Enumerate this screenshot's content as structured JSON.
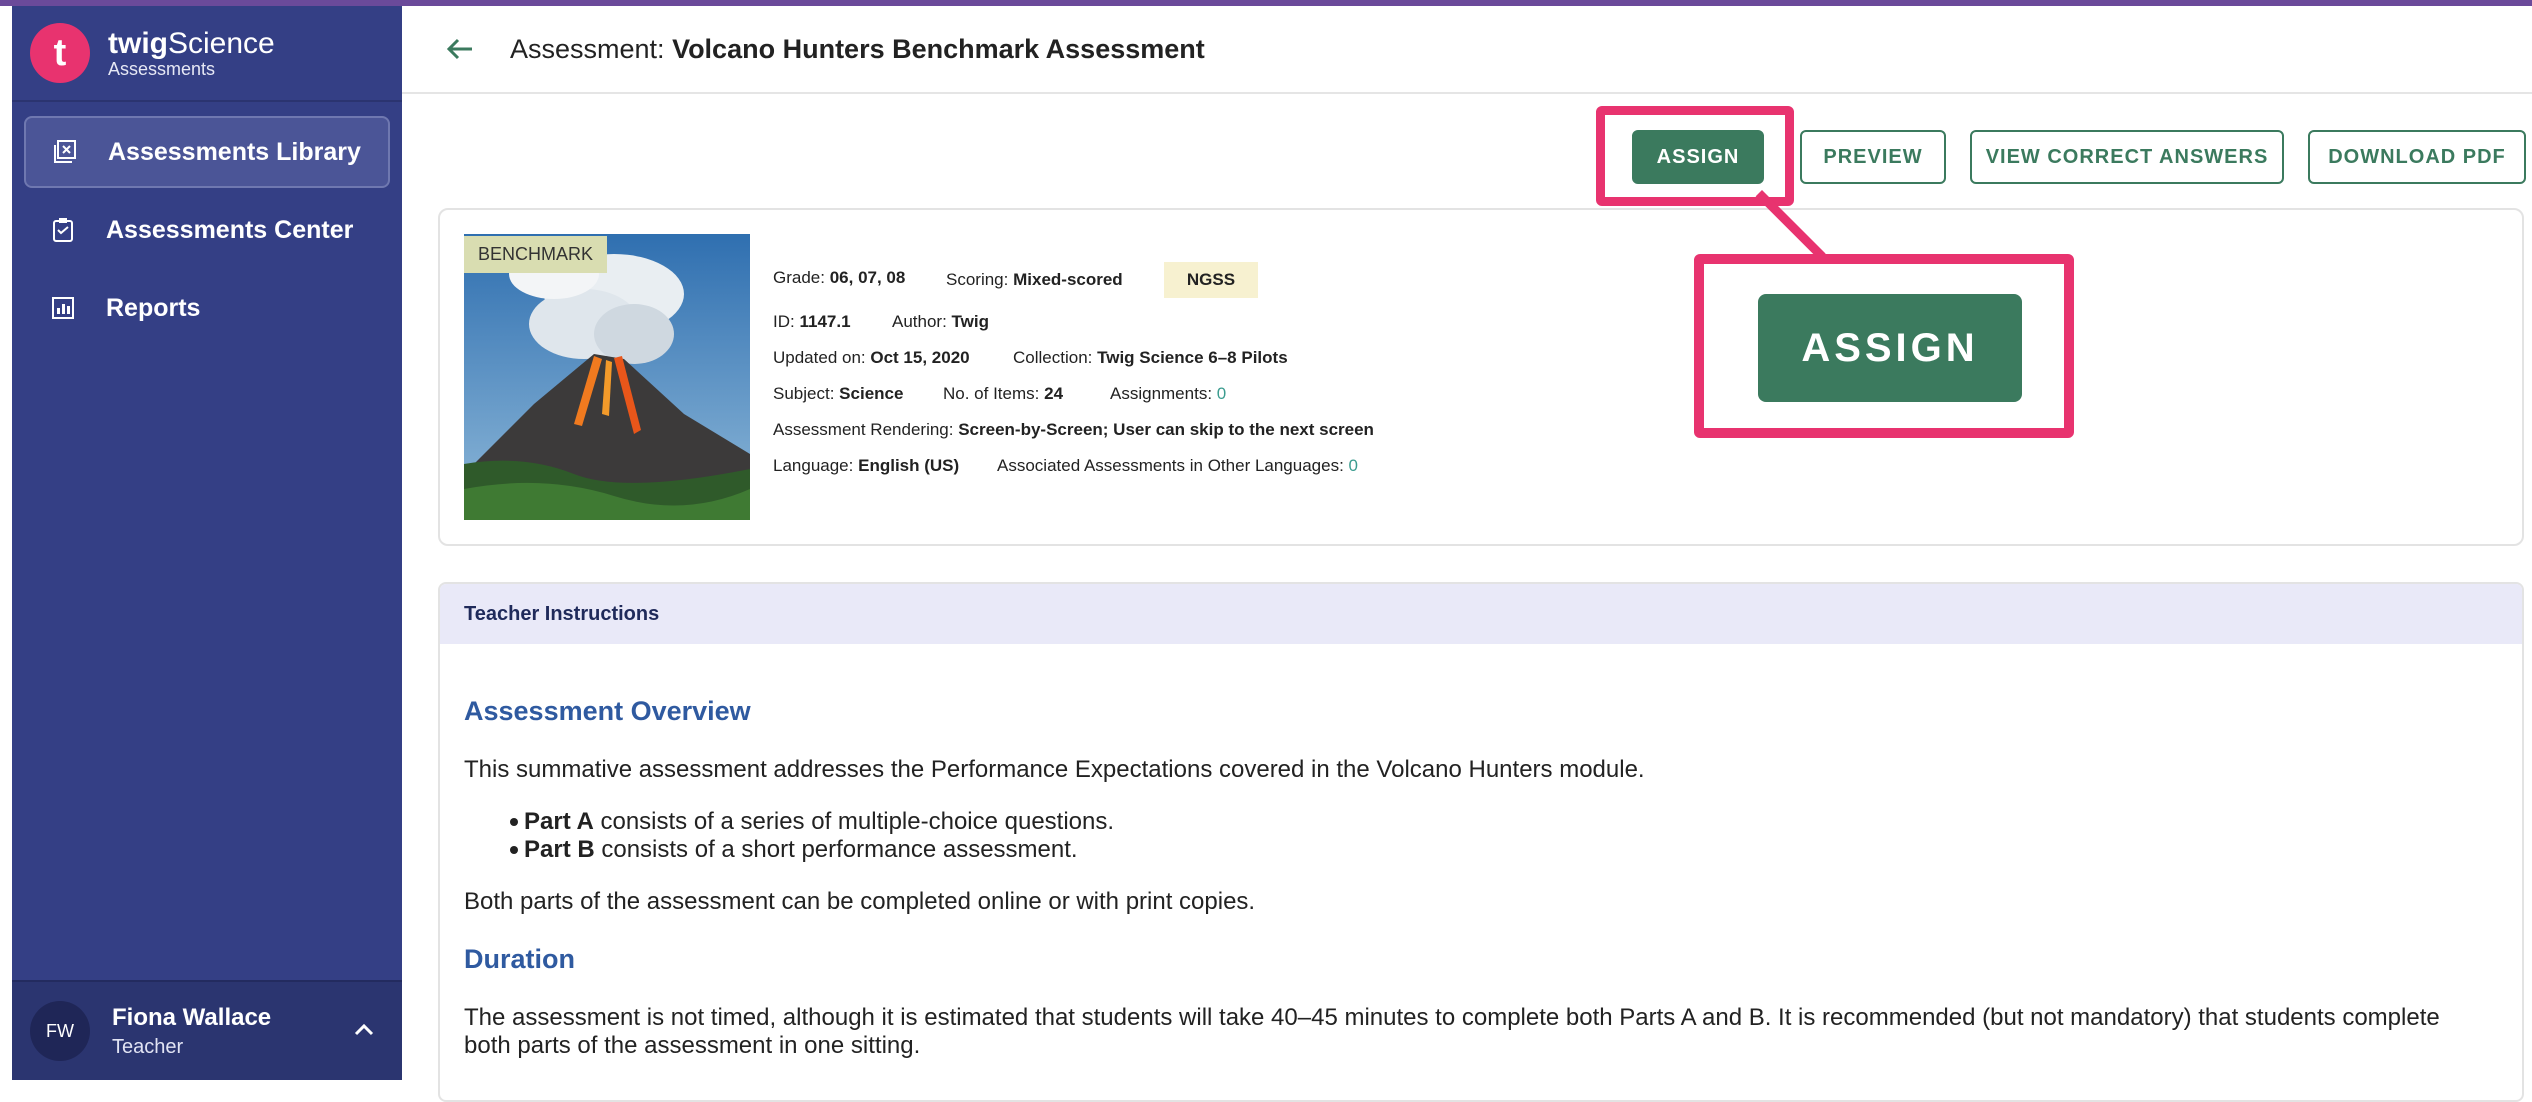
{
  "colors": {
    "sidebar": "#343f85",
    "accent_pink": "#e8336f",
    "primary_green": "#3b7a5e",
    "heading_blue": "#2f5aa0"
  },
  "brand": {
    "logo_letter": "t",
    "name_prefix": "twig",
    "name_suffix": "Science",
    "sub": "Assessments"
  },
  "nav": {
    "items": [
      {
        "label": "Assessments Library",
        "icon": "library-icon",
        "active": true
      },
      {
        "label": "Assessments Center",
        "icon": "clipboard-icon",
        "active": false
      },
      {
        "label": "Reports",
        "icon": "chart-icon",
        "active": false
      }
    ]
  },
  "user": {
    "initials": "FW",
    "name": "Fiona Wallace",
    "role": "Teacher"
  },
  "header": {
    "title_prefix": "Assessment: ",
    "title_name": "Volcano Hunters Benchmark Assessment"
  },
  "actions": {
    "assign": "ASSIGN",
    "preview": "PREVIEW",
    "view_answers": "VIEW CORRECT ANSWERS",
    "download": "DOWNLOAD PDF",
    "assign_zoom": "ASSIGN"
  },
  "details": {
    "badge": "BENCHMARK",
    "grade_label": "Grade:",
    "grade": "06, 07, 08",
    "scoring_label": "Scoring:",
    "scoring": "Mixed-scored",
    "standard": "NGSS",
    "id_label": "ID:",
    "id": "1147.1",
    "author_label": "Author:",
    "author": "Twig",
    "updated_label": "Updated on:",
    "updated": "Oct 15, 2020",
    "collection_label": "Collection:",
    "collection": "Twig Science 6–8 Pilots",
    "subject_label": "Subject:",
    "subject": "Science",
    "items_label": "No. of Items:",
    "items": "24",
    "assignments_label": "Assignments:",
    "assignments": "0",
    "rendering_label": "Assessment Rendering:",
    "rendering": "Screen-by-Screen; User can skip to the next screen",
    "language_label": "Language:",
    "language": "English (US)",
    "associated_label": "Associated Assessments in Other Languages:",
    "associated": "0"
  },
  "instructions": {
    "header": "Teacher Instructions",
    "overview_title": "Assessment Overview",
    "overview_text": "This summative assessment addresses the Performance Expectations covered in the Volcano Hunters module.",
    "part_a_bold": "Part A",
    "part_a_text": " consists of a series of multiple-choice questions.",
    "part_b_bold": "Part B",
    "part_b_text": " consists of a short performance assessment.",
    "both_text": "Both parts of the assessment can be completed online or with print copies.",
    "duration_title": "Duration",
    "duration_line1": "The assessment is not timed, although it is estimated that students will take 40–45 minutes to complete both Parts A and B. It is recommended (but not mandatory) that students complete",
    "duration_line2": "both parts of the assessment in one sitting."
  }
}
